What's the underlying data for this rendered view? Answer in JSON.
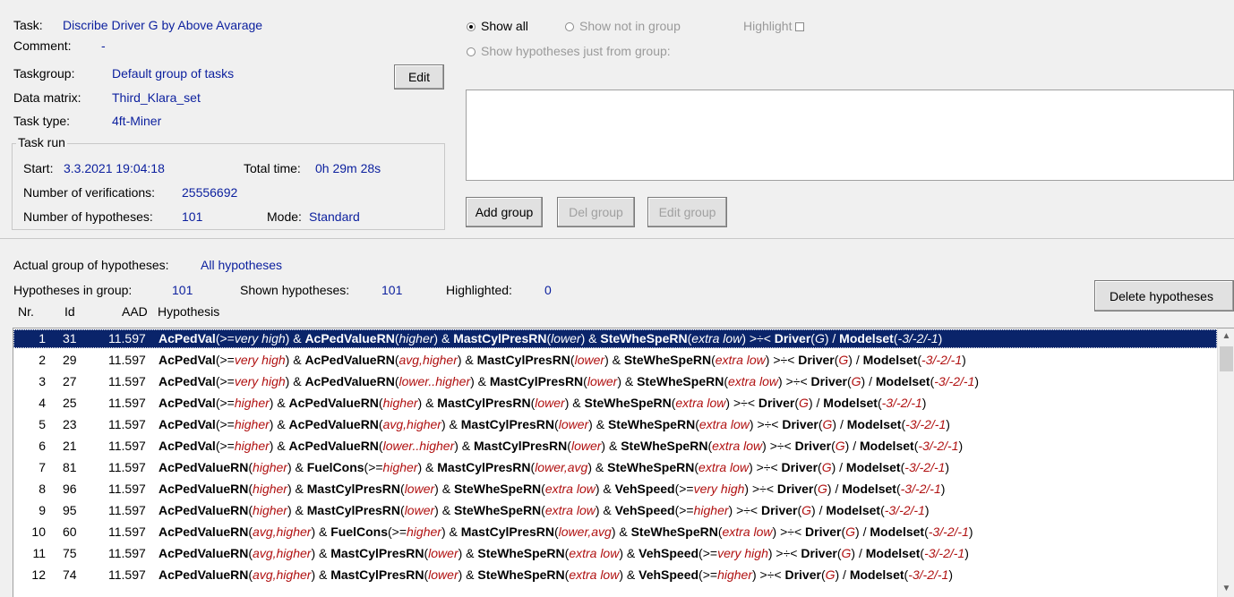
{
  "task": {
    "task_label": "Task:",
    "task_value": "Discribe Driver G by Above Avarage",
    "comment_label": "Comment:",
    "comment_value": "-",
    "taskgroup_label": "Taskgroup:",
    "taskgroup_value": "Default group of tasks",
    "datamatrix_label": "Data matrix:",
    "datamatrix_value": "Third_Klara_set",
    "tasktype_label": "Task type:",
    "tasktype_value": "4ft-Miner",
    "edit_button": "Edit"
  },
  "task_run": {
    "legend": "Task run",
    "start_label": "Start:",
    "start_value": "3.3.2021 19:04:18",
    "total_label": "Total time:",
    "total_value": "0h 29m 28s",
    "verif_label": "Number of verifications:",
    "verif_value": "25556692",
    "hyp_label": "Number of hypotheses:",
    "hyp_value": "101",
    "mode_label": "Mode:",
    "mode_value": "Standard"
  },
  "filter": {
    "show_all": "Show all",
    "show_not_in_group": "Show not in group",
    "highlight": "Highlight",
    "show_from_group": "Show hypotheses just from group:",
    "add_group": "Add group",
    "del_group": "Del group",
    "edit_group": "Edit group"
  },
  "summary": {
    "actual_label": "Actual group of hypotheses:",
    "actual_value": "All hypotheses",
    "in_group_label": "Hypotheses in group:",
    "in_group_value": "101",
    "shown_label": "Shown hypotheses:",
    "shown_value": "101",
    "highlighted_label": "Highlighted:",
    "highlighted_value": "0",
    "delete_button": "Delete hypotheses"
  },
  "columns": {
    "nr": "Nr.",
    "id": "Id",
    "aad": "AAD",
    "hypothesis": "Hypothesis"
  },
  "rows": [
    {
      "nr": "1",
      "id": "31",
      "aad": "11.597",
      "hyp": [
        [
          "b",
          "AcPedVal"
        ],
        [
          "t",
          "(>="
        ],
        [
          "i",
          "very high"
        ],
        [
          "t",
          ") & "
        ],
        [
          "b",
          "AcPedValueRN"
        ],
        [
          "t",
          "("
        ],
        [
          "i",
          "higher"
        ],
        [
          "t",
          ") & "
        ],
        [
          "b",
          "MastCylPresRN"
        ],
        [
          "t",
          "("
        ],
        [
          "i",
          "lower"
        ],
        [
          "t",
          ") & "
        ],
        [
          "b",
          "SteWheSpeRN"
        ],
        [
          "t",
          "("
        ],
        [
          "i",
          "extra low"
        ],
        [
          "t",
          ") >÷< "
        ],
        [
          "b",
          "Driver"
        ],
        [
          "t",
          "("
        ],
        [
          "i",
          "G"
        ],
        [
          "t",
          ") / "
        ],
        [
          "b",
          "Modelset"
        ],
        [
          "t",
          "("
        ],
        [
          "i",
          "-3/-2/-1"
        ],
        [
          "t",
          ")"
        ]
      ]
    },
    {
      "nr": "2",
      "id": "29",
      "aad": "11.597",
      "hyp": [
        [
          "b",
          "AcPedVal"
        ],
        [
          "t",
          "(>="
        ],
        [
          "i",
          "very high"
        ],
        [
          "t",
          ") & "
        ],
        [
          "b",
          "AcPedValueRN"
        ],
        [
          "t",
          "("
        ],
        [
          "i",
          "avg,higher"
        ],
        [
          "t",
          ") & "
        ],
        [
          "b",
          "MastCylPresRN"
        ],
        [
          "t",
          "("
        ],
        [
          "i",
          "lower"
        ],
        [
          "t",
          ") & "
        ],
        [
          "b",
          "SteWheSpeRN"
        ],
        [
          "t",
          "("
        ],
        [
          "i",
          "extra low"
        ],
        [
          "t",
          ") >÷< "
        ],
        [
          "b",
          "Driver"
        ],
        [
          "t",
          "("
        ],
        [
          "i",
          "G"
        ],
        [
          "t",
          ") / "
        ],
        [
          "b",
          "Modelset"
        ],
        [
          "t",
          "("
        ],
        [
          "i",
          "-3/-2/-1"
        ],
        [
          "t",
          ")"
        ]
      ]
    },
    {
      "nr": "3",
      "id": "27",
      "aad": "11.597",
      "hyp": [
        [
          "b",
          "AcPedVal"
        ],
        [
          "t",
          "(>="
        ],
        [
          "i",
          "very high"
        ],
        [
          "t",
          ") & "
        ],
        [
          "b",
          "AcPedValueRN"
        ],
        [
          "t",
          "("
        ],
        [
          "i",
          "lower..higher"
        ],
        [
          "t",
          ") & "
        ],
        [
          "b",
          "MastCylPresRN"
        ],
        [
          "t",
          "("
        ],
        [
          "i",
          "lower"
        ],
        [
          "t",
          ") & "
        ],
        [
          "b",
          "SteWheSpeRN"
        ],
        [
          "t",
          "("
        ],
        [
          "i",
          "extra low"
        ],
        [
          "t",
          ") >÷< "
        ],
        [
          "b",
          "Driver"
        ],
        [
          "t",
          "("
        ],
        [
          "i",
          "G"
        ],
        [
          "t",
          ") / "
        ],
        [
          "b",
          "Modelset"
        ],
        [
          "t",
          "("
        ],
        [
          "i",
          "-3/-2/-1"
        ],
        [
          "t",
          ")"
        ]
      ]
    },
    {
      "nr": "4",
      "id": "25",
      "aad": "11.597",
      "hyp": [
        [
          "b",
          "AcPedVal"
        ],
        [
          "t",
          "(>="
        ],
        [
          "i",
          "higher"
        ],
        [
          "t",
          ") & "
        ],
        [
          "b",
          "AcPedValueRN"
        ],
        [
          "t",
          "("
        ],
        [
          "i",
          "higher"
        ],
        [
          "t",
          ") & "
        ],
        [
          "b",
          "MastCylPresRN"
        ],
        [
          "t",
          "("
        ],
        [
          "i",
          "lower"
        ],
        [
          "t",
          ") & "
        ],
        [
          "b",
          "SteWheSpeRN"
        ],
        [
          "t",
          "("
        ],
        [
          "i",
          "extra low"
        ],
        [
          "t",
          ") >÷< "
        ],
        [
          "b",
          "Driver"
        ],
        [
          "t",
          "("
        ],
        [
          "i",
          "G"
        ],
        [
          "t",
          ") / "
        ],
        [
          "b",
          "Modelset"
        ],
        [
          "t",
          "("
        ],
        [
          "i",
          "-3/-2/-1"
        ],
        [
          "t",
          ")"
        ]
      ]
    },
    {
      "nr": "5",
      "id": "23",
      "aad": "11.597",
      "hyp": [
        [
          "b",
          "AcPedVal"
        ],
        [
          "t",
          "(>="
        ],
        [
          "i",
          "higher"
        ],
        [
          "t",
          ") & "
        ],
        [
          "b",
          "AcPedValueRN"
        ],
        [
          "t",
          "("
        ],
        [
          "i",
          "avg,higher"
        ],
        [
          "t",
          ") & "
        ],
        [
          "b",
          "MastCylPresRN"
        ],
        [
          "t",
          "("
        ],
        [
          "i",
          "lower"
        ],
        [
          "t",
          ") & "
        ],
        [
          "b",
          "SteWheSpeRN"
        ],
        [
          "t",
          "("
        ],
        [
          "i",
          "extra low"
        ],
        [
          "t",
          ") >÷< "
        ],
        [
          "b",
          "Driver"
        ],
        [
          "t",
          "("
        ],
        [
          "i",
          "G"
        ],
        [
          "t",
          ") / "
        ],
        [
          "b",
          "Modelset"
        ],
        [
          "t",
          "("
        ],
        [
          "i",
          "-3/-2/-1"
        ],
        [
          "t",
          ")"
        ]
      ]
    },
    {
      "nr": "6",
      "id": "21",
      "aad": "11.597",
      "hyp": [
        [
          "b",
          "AcPedVal"
        ],
        [
          "t",
          "(>="
        ],
        [
          "i",
          "higher"
        ],
        [
          "t",
          ") & "
        ],
        [
          "b",
          "AcPedValueRN"
        ],
        [
          "t",
          "("
        ],
        [
          "i",
          "lower..higher"
        ],
        [
          "t",
          ") & "
        ],
        [
          "b",
          "MastCylPresRN"
        ],
        [
          "t",
          "("
        ],
        [
          "i",
          "lower"
        ],
        [
          "t",
          ") & "
        ],
        [
          "b",
          "SteWheSpeRN"
        ],
        [
          "t",
          "("
        ],
        [
          "i",
          "extra low"
        ],
        [
          "t",
          ") >÷< "
        ],
        [
          "b",
          "Driver"
        ],
        [
          "t",
          "("
        ],
        [
          "i",
          "G"
        ],
        [
          "t",
          ") / "
        ],
        [
          "b",
          "Modelset"
        ],
        [
          "t",
          "("
        ],
        [
          "i",
          "-3/-2/-1"
        ],
        [
          "t",
          ")"
        ]
      ]
    },
    {
      "nr": "7",
      "id": "81",
      "aad": "11.597",
      "hyp": [
        [
          "b",
          "AcPedValueRN"
        ],
        [
          "t",
          "("
        ],
        [
          "i",
          "higher"
        ],
        [
          "t",
          ") & "
        ],
        [
          "b",
          "FuelCons"
        ],
        [
          "t",
          "(>="
        ],
        [
          "i",
          "higher"
        ],
        [
          "t",
          ") & "
        ],
        [
          "b",
          "MastCylPresRN"
        ],
        [
          "t",
          "("
        ],
        [
          "i",
          "lower,avg"
        ],
        [
          "t",
          ") & "
        ],
        [
          "b",
          "SteWheSpeRN"
        ],
        [
          "t",
          "("
        ],
        [
          "i",
          "extra low"
        ],
        [
          "t",
          ") >÷< "
        ],
        [
          "b",
          "Driver"
        ],
        [
          "t",
          "("
        ],
        [
          "i",
          "G"
        ],
        [
          "t",
          ") / "
        ],
        [
          "b",
          "Modelset"
        ],
        [
          "t",
          "("
        ],
        [
          "i",
          "-3/-2/-1"
        ],
        [
          "t",
          ")"
        ]
      ]
    },
    {
      "nr": "8",
      "id": "96",
      "aad": "11.597",
      "hyp": [
        [
          "b",
          "AcPedValueRN"
        ],
        [
          "t",
          "("
        ],
        [
          "i",
          "higher"
        ],
        [
          "t",
          ") & "
        ],
        [
          "b",
          "MastCylPresRN"
        ],
        [
          "t",
          "("
        ],
        [
          "i",
          "lower"
        ],
        [
          "t",
          ") & "
        ],
        [
          "b",
          "SteWheSpeRN"
        ],
        [
          "t",
          "("
        ],
        [
          "i",
          "extra low"
        ],
        [
          "t",
          ") & "
        ],
        [
          "b",
          "VehSpeed"
        ],
        [
          "t",
          "(>="
        ],
        [
          "i",
          "very high"
        ],
        [
          "t",
          ") >÷< "
        ],
        [
          "b",
          "Driver"
        ],
        [
          "t",
          "("
        ],
        [
          "i",
          "G"
        ],
        [
          "t",
          ") / "
        ],
        [
          "b",
          "Modelset"
        ],
        [
          "t",
          "("
        ],
        [
          "i",
          "-3/-2/-1"
        ],
        [
          "t",
          ")"
        ]
      ]
    },
    {
      "nr": "9",
      "id": "95",
      "aad": "11.597",
      "hyp": [
        [
          "b",
          "AcPedValueRN"
        ],
        [
          "t",
          "("
        ],
        [
          "i",
          "higher"
        ],
        [
          "t",
          ") & "
        ],
        [
          "b",
          "MastCylPresRN"
        ],
        [
          "t",
          "("
        ],
        [
          "i",
          "lower"
        ],
        [
          "t",
          ") & "
        ],
        [
          "b",
          "SteWheSpeRN"
        ],
        [
          "t",
          "("
        ],
        [
          "i",
          "extra low"
        ],
        [
          "t",
          ") & "
        ],
        [
          "b",
          "VehSpeed"
        ],
        [
          "t",
          "(>="
        ],
        [
          "i",
          "higher"
        ],
        [
          "t",
          ") >÷< "
        ],
        [
          "b",
          "Driver"
        ],
        [
          "t",
          "("
        ],
        [
          "i",
          "G"
        ],
        [
          "t",
          ") / "
        ],
        [
          "b",
          "Modelset"
        ],
        [
          "t",
          "("
        ],
        [
          "i",
          "-3/-2/-1"
        ],
        [
          "t",
          ")"
        ]
      ]
    },
    {
      "nr": "10",
      "id": "60",
      "aad": "11.597",
      "hyp": [
        [
          "b",
          "AcPedValueRN"
        ],
        [
          "t",
          "("
        ],
        [
          "i",
          "avg,higher"
        ],
        [
          "t",
          ") & "
        ],
        [
          "b",
          "FuelCons"
        ],
        [
          "t",
          "(>="
        ],
        [
          "i",
          "higher"
        ],
        [
          "t",
          ") & "
        ],
        [
          "b",
          "MastCylPresRN"
        ],
        [
          "t",
          "("
        ],
        [
          "i",
          "lower,avg"
        ],
        [
          "t",
          ") & "
        ],
        [
          "b",
          "SteWheSpeRN"
        ],
        [
          "t",
          "("
        ],
        [
          "i",
          "extra low"
        ],
        [
          "t",
          ") >÷< "
        ],
        [
          "b",
          "Driver"
        ],
        [
          "t",
          "("
        ],
        [
          "i",
          "G"
        ],
        [
          "t",
          ") / "
        ],
        [
          "b",
          "Modelset"
        ],
        [
          "t",
          "("
        ],
        [
          "i",
          "-3/-2/-1"
        ],
        [
          "t",
          ")"
        ]
      ]
    },
    {
      "nr": "11",
      "id": "75",
      "aad": "11.597",
      "hyp": [
        [
          "b",
          "AcPedValueRN"
        ],
        [
          "t",
          "("
        ],
        [
          "i",
          "avg,higher"
        ],
        [
          "t",
          ") & "
        ],
        [
          "b",
          "MastCylPresRN"
        ],
        [
          "t",
          "("
        ],
        [
          "i",
          "lower"
        ],
        [
          "t",
          ") & "
        ],
        [
          "b",
          "SteWheSpeRN"
        ],
        [
          "t",
          "("
        ],
        [
          "i",
          "extra low"
        ],
        [
          "t",
          ") & "
        ],
        [
          "b",
          "VehSpeed"
        ],
        [
          "t",
          "(>="
        ],
        [
          "i",
          "very high"
        ],
        [
          "t",
          ") >÷< "
        ],
        [
          "b",
          "Driver"
        ],
        [
          "t",
          "("
        ],
        [
          "i",
          "G"
        ],
        [
          "t",
          ") / "
        ],
        [
          "b",
          "Modelset"
        ],
        [
          "t",
          "("
        ],
        [
          "i",
          "-3/-2/-1"
        ],
        [
          "t",
          ")"
        ]
      ]
    },
    {
      "nr": "12",
      "id": "74",
      "aad": "11.597",
      "hyp": [
        [
          "b",
          "AcPedValueRN"
        ],
        [
          "t",
          "("
        ],
        [
          "i",
          "avg,higher"
        ],
        [
          "t",
          ") & "
        ],
        [
          "b",
          "MastCylPresRN"
        ],
        [
          "t",
          "("
        ],
        [
          "i",
          "lower"
        ],
        [
          "t",
          ") & "
        ],
        [
          "b",
          "SteWheSpeRN"
        ],
        [
          "t",
          "("
        ],
        [
          "i",
          "extra low"
        ],
        [
          "t",
          ") & "
        ],
        [
          "b",
          "VehSpeed"
        ],
        [
          "t",
          "(>="
        ],
        [
          "i",
          "higher"
        ],
        [
          "t",
          ") >÷< "
        ],
        [
          "b",
          "Driver"
        ],
        [
          "t",
          "("
        ],
        [
          "i",
          "G"
        ],
        [
          "t",
          ") / "
        ],
        [
          "b",
          "Modelset"
        ],
        [
          "t",
          "("
        ],
        [
          "i",
          "-3/-2/-1"
        ],
        [
          "t",
          ")"
        ]
      ]
    }
  ]
}
